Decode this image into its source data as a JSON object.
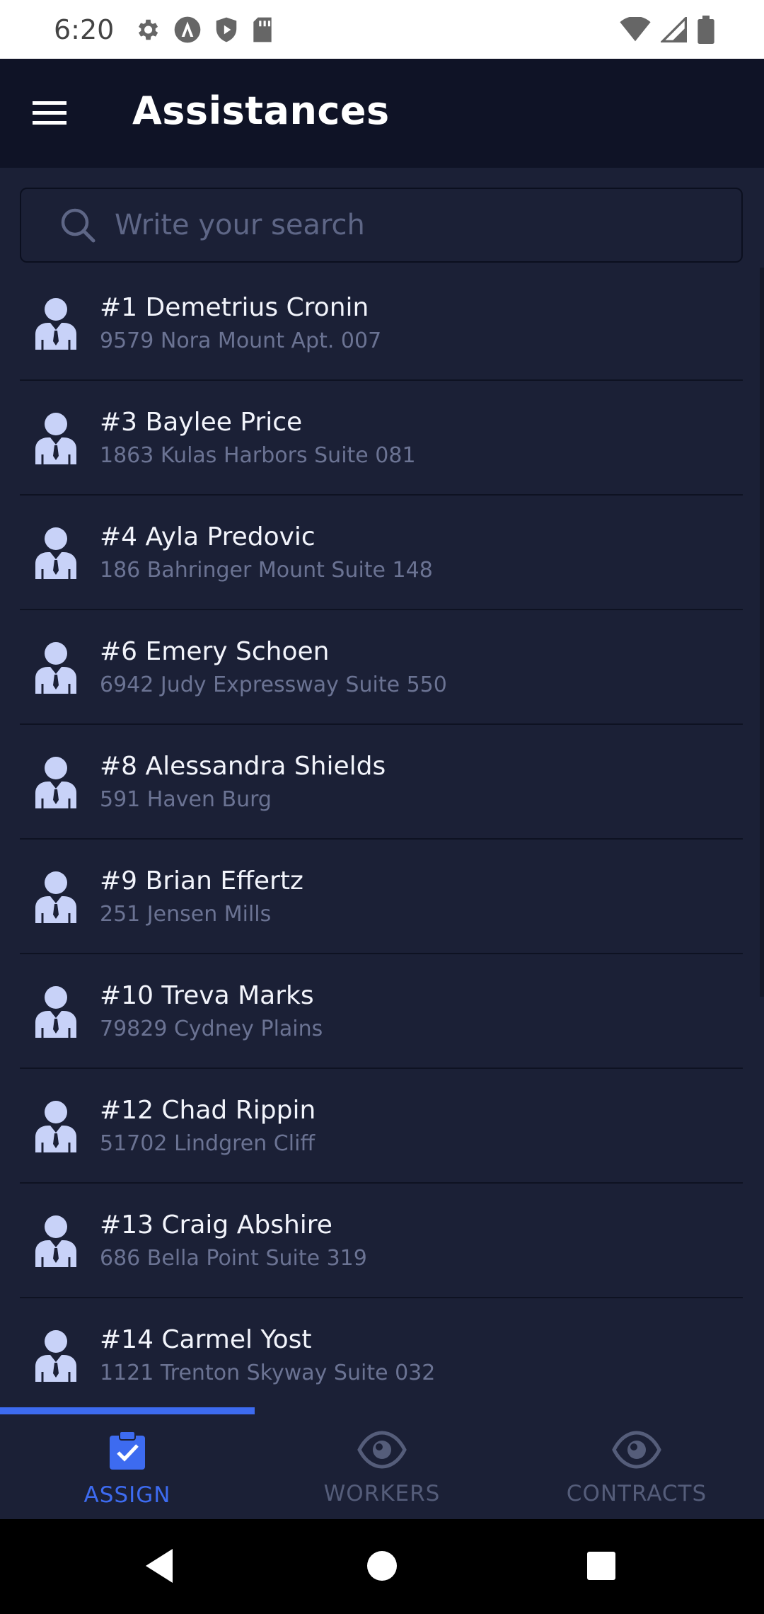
{
  "status_bar": {
    "time": "6:20",
    "left_icons": [
      "settings-icon",
      "android-auto-icon",
      "shield-icon",
      "sd-card-icon"
    ],
    "right_icons": [
      "wifi-icon",
      "signal-icon",
      "battery-icon"
    ]
  },
  "app_bar": {
    "menu_icon": "hamburger-menu-icon",
    "title": "Assistances"
  },
  "search": {
    "icon": "search-icon",
    "placeholder": "Write your search",
    "value": ""
  },
  "list": {
    "items": [
      {
        "title": "#1 Demetrius Cronin",
        "subtitle": "9579 Nora Mount Apt. 007"
      },
      {
        "title": "#3 Baylee Price",
        "subtitle": "1863 Kulas Harbors Suite 081"
      },
      {
        "title": "#4 Ayla Predovic",
        "subtitle": "186 Bahringer Mount Suite 148"
      },
      {
        "title": "#6 Emery Schoen",
        "subtitle": "6942 Judy Expressway Suite 550"
      },
      {
        "title": "#8 Alessandra Shields",
        "subtitle": "591 Haven Burg"
      },
      {
        "title": "#9 Brian Effertz",
        "subtitle": "251 Jensen Mills"
      },
      {
        "title": "#10 Treva Marks",
        "subtitle": "79829 Cydney Plains"
      },
      {
        "title": "#12 Chad Rippin",
        "subtitle": "51702 Lindgren Cliff"
      },
      {
        "title": "#13 Craig Abshire",
        "subtitle": "686 Bella Point Suite 319"
      },
      {
        "title": "#14 Carmel Yost",
        "subtitle": "1121 Trenton Skyway Suite 032"
      }
    ]
  },
  "bottom_nav": {
    "tabs": [
      {
        "label": "ASSIGN",
        "icon": "clipboard-check-icon",
        "active": true
      },
      {
        "label": "WORKERS",
        "icon": "eye-icon",
        "active": false
      },
      {
        "label": "CONTRACTS",
        "icon": "eye-icon",
        "active": false
      }
    ]
  },
  "colors": {
    "accent": "#3d6bf0",
    "background": "#1b2036",
    "app_bar": "#0f1326",
    "icon": "#c8d2f8"
  }
}
